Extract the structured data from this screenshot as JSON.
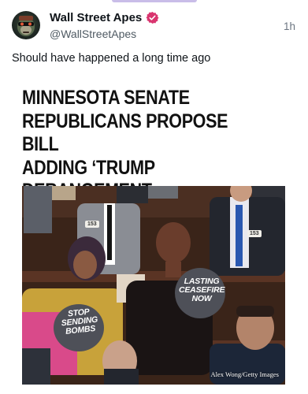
{
  "post": {
    "author": {
      "display_name": "Wall Street Apes",
      "handle": "@WallStreetApes",
      "verified_badge": "verified-badge-icon",
      "avatar_icon": "ape-avatar-icon"
    },
    "timestamp": "1h",
    "text": "Should have happened a long time ago"
  },
  "media": {
    "headline": "MINNESOTA SENATE\nREPUBLICANS PROPOSE BILL\nADDING ‘TRUMP DERANGEMENT\nSYNDROME’ AS MENTAL ILLNESS",
    "photo": {
      "sign_ceasefire": "LASTING\nCEASEFIRE\nNOW",
      "sign_bombs": "STOP\nSENDING\nBOMBS",
      "placard_left": "153",
      "placard_right": "153",
      "credit": "Alex Wong/Getty Images"
    }
  },
  "colors": {
    "accent": "#c9bde8",
    "verified_badge": "#d9356f",
    "text_primary": "#0f1419",
    "text_secondary": "#4f5a63"
  }
}
